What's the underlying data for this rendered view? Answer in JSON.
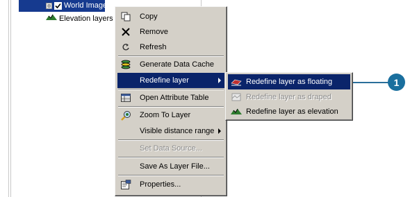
{
  "toc": {
    "items": [
      {
        "label": "World Image",
        "expander": "⊞",
        "checked": true
      },
      {
        "label": "Elevation layers"
      }
    ]
  },
  "context_menu": {
    "items": [
      {
        "label": "Copy",
        "icon": "copy-icon"
      },
      {
        "label": "Remove",
        "icon": "remove-icon"
      },
      {
        "label": "Refresh",
        "icon": "refresh-icon"
      },
      {
        "label": "Generate Data Cache",
        "icon": "data-cache-icon"
      },
      {
        "label": "Redefine layer",
        "highlighted": true,
        "has_submenu": true
      },
      {
        "label": "Open Attribute Table",
        "icon": "table-icon"
      },
      {
        "label": "Zoom To Layer",
        "icon": "zoom-icon"
      },
      {
        "label": "Visible distance range",
        "has_submenu": true
      },
      {
        "label": "Set Data Source...",
        "disabled": true
      },
      {
        "label": "Save As Layer File..."
      },
      {
        "label": "Properties...",
        "icon": "properties-icon"
      }
    ]
  },
  "submenu": {
    "items": [
      {
        "label": "Redefine layer as floating",
        "highlighted": true,
        "icon": "floating-layer-icon"
      },
      {
        "label": "Redefine layer as draped",
        "disabled": true,
        "icon": "draped-layer-icon"
      },
      {
        "label": "Redefine layer as elevation",
        "icon": "elevation-layer-icon"
      }
    ]
  },
  "callout": {
    "number": "1"
  },
  "colors": {
    "selection": "#0a246a",
    "menu_bg": "#d4d0c8",
    "callout": "#1a6f9e"
  }
}
